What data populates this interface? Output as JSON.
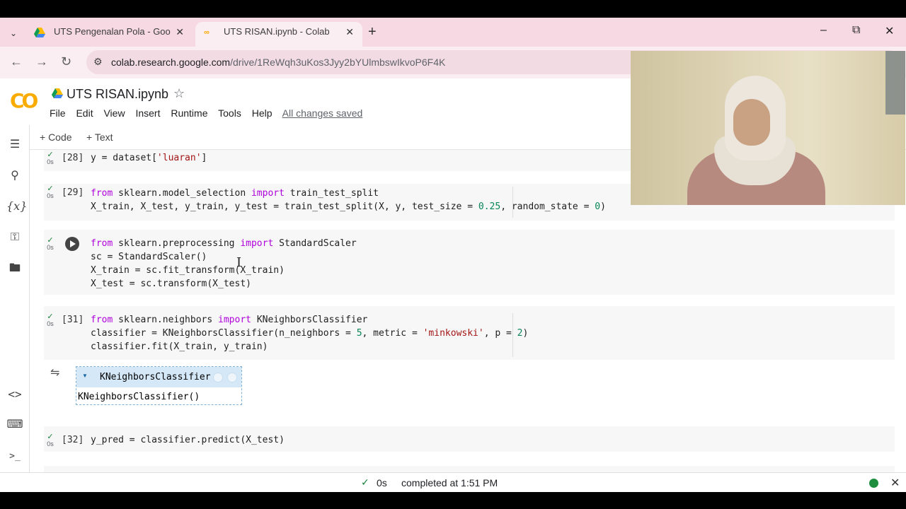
{
  "browser": {
    "tabs": [
      {
        "label": "UTS Pengenalan Pola - Google",
        "active": false
      },
      {
        "label": "UTS RISAN.ipynb - Colab",
        "active": true
      }
    ],
    "url_host": "colab.research.google.com",
    "url_path": "/drive/1ReWqh3uKos3Jyy2bYUlmbswIkvoP6F4K"
  },
  "colab": {
    "logo": "CO",
    "title": "UTS RISAN.ipynb",
    "menu": [
      "File",
      "Edit",
      "View",
      "Insert",
      "Runtime",
      "Tools",
      "Help"
    ],
    "saved_status": "All changes saved",
    "toolbar": {
      "code_label": "+ Code",
      "text_label": "+ Text"
    }
  },
  "cells": {
    "c28": {
      "exec": "[28]",
      "time": "0s",
      "line1": "y = dataset[",
      "str1": "'luaran'",
      "end1": "]"
    },
    "c29": {
      "exec": "[29]",
      "time": "0s",
      "kw_from": "from",
      "mod": " sklearn.model_selection ",
      "kw_import": "import",
      "name": " train_test_split",
      "l2a": "X_train, X_test, y_train, y_test = train_test_split(X, y, test_size = ",
      "num1": "0.25",
      "l2b": ", random_state = ",
      "num2": "0",
      "l2c": ")"
    },
    "c30": {
      "time": "0s",
      "kw_from": "from",
      "mod": " sklearn.preprocessing ",
      "kw_import": "import",
      "name": " StandardScaler",
      "l2": "sc = StandardScaler()",
      "l3": "X_train = sc.fit_transform(X_train)",
      "l4": "X_test = sc.transform(X_test)"
    },
    "c31": {
      "exec": "[31]",
      "time": "0s",
      "kw_from": "from",
      "mod": " sklearn.neighbors ",
      "kw_import": "import",
      "name": " KNeighborsClassifier",
      "l2a": "classifier = KNeighborsClassifier(n_neighbors = ",
      "num1": "5",
      "l2b": ", metric = ",
      "str1": "'minkowski'",
      "l2c": ", p = ",
      "num2": "2",
      "l2d": ")",
      "l3": "classifier.fit(X_train, y_train)",
      "output": {
        "head": "KNeighborsClassifier",
        "body": "KNeighborsClassifier()"
      }
    },
    "c32": {
      "exec": "[32]",
      "time": "0s",
      "line1": "y_pred = classifier.predict(X_test)"
    }
  },
  "status_bar": {
    "time": "0s",
    "text": "completed at 1:51 PM"
  },
  "colors": {
    "accent": "#f9ab00",
    "keyword": "#af00db",
    "string": "#a31515",
    "number": "#098658",
    "ok": "#188038"
  }
}
